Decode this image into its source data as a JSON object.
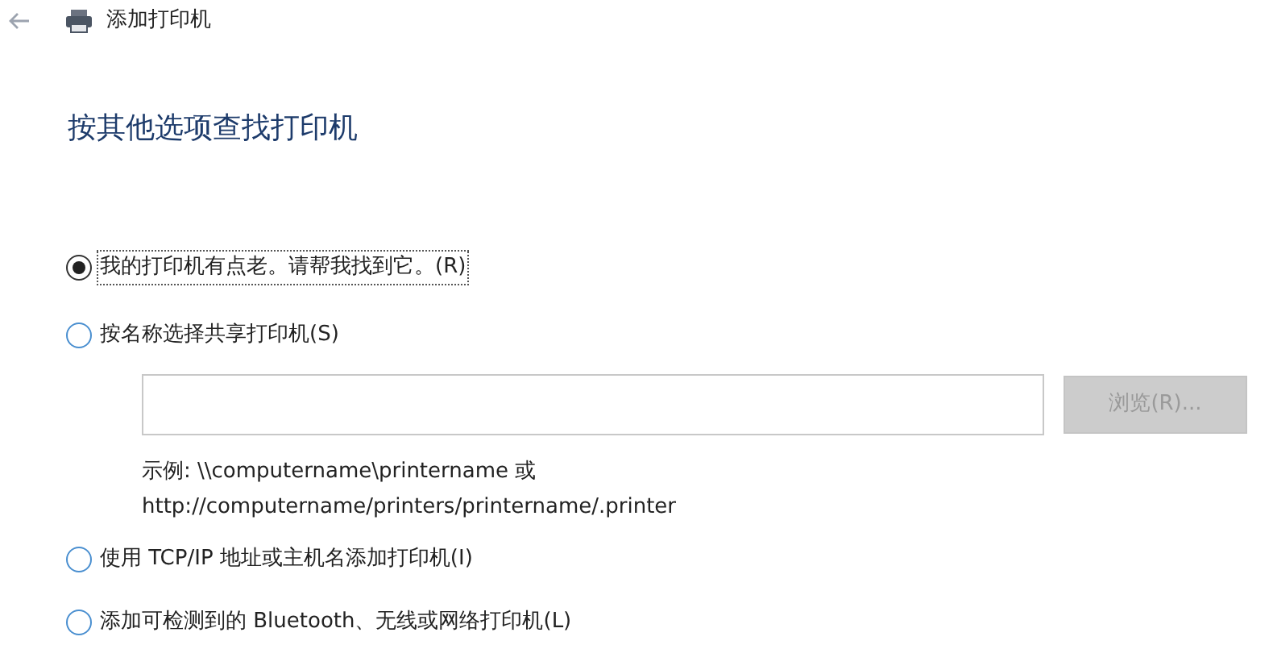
{
  "window": {
    "title": "添加打印机"
  },
  "heading": "按其他选项查找打印机",
  "options": [
    {
      "label": "我的打印机有点老。请帮我找到它。(R)",
      "selected": true,
      "focused": true
    },
    {
      "label": "按名称选择共享打印机(S)",
      "selected": false,
      "focused": false
    },
    {
      "label": "使用 TCP/IP 地址或主机名添加打印机(I)",
      "selected": false,
      "focused": false
    },
    {
      "label": "添加可检测到的 Bluetooth、无线或网络打印机(L)",
      "selected": false,
      "focused": false
    }
  ],
  "share_field": {
    "browse_button": {
      "label": "浏览(R)...",
      "disabled": true
    },
    "example_lines": [
      "示例: \\\\computername\\printername 或",
      "http://computername/printers/printername/.printer"
    ]
  }
}
